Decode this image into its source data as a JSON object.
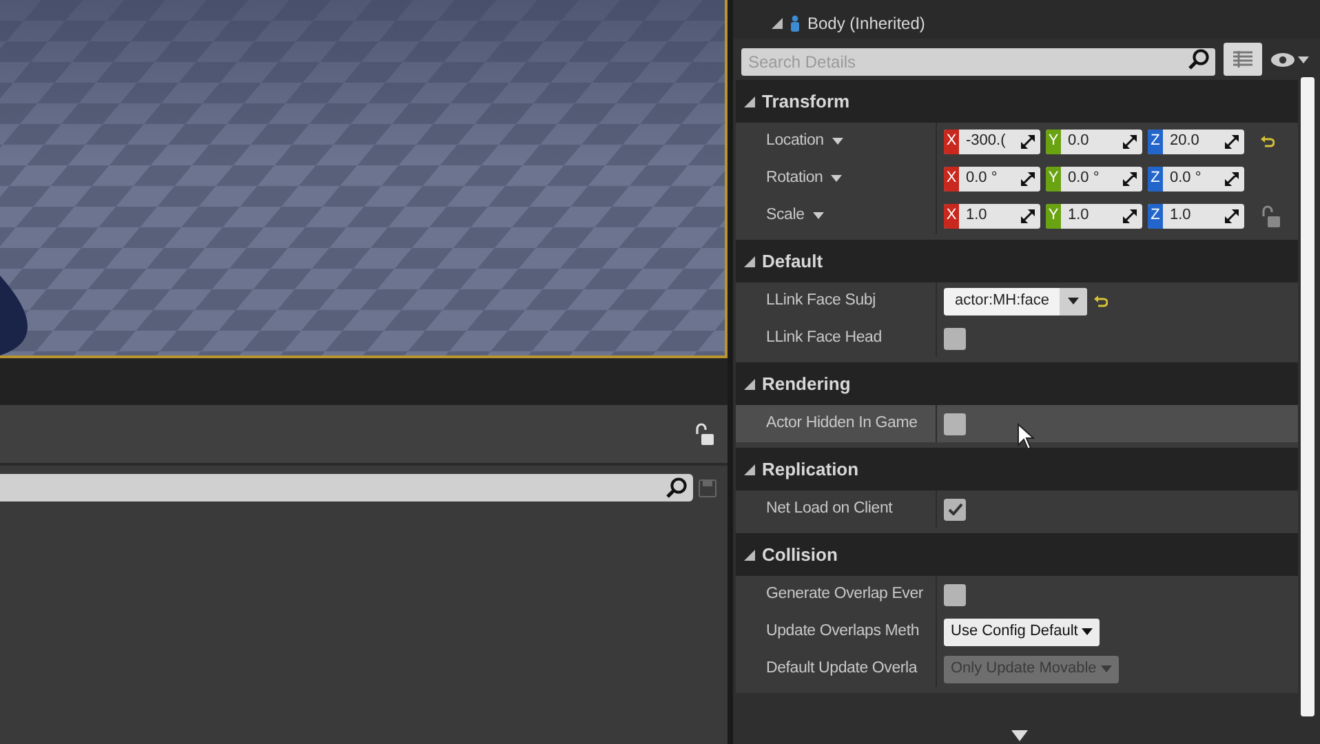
{
  "outliner": {
    "items": [
      {
        "label": "Body (Inherited)",
        "expanded": true
      }
    ]
  },
  "details": {
    "search": {
      "placeholder": "Search Details"
    },
    "sections": [
      {
        "title": "Transform",
        "expanded": true,
        "rows": [
          {
            "kind": "vector",
            "label": "Location",
            "modified": true,
            "hovered": false,
            "fields": [
              {
                "axis": "X",
                "value": "-300.("
              },
              {
                "axis": "Y",
                "value": "0.0"
              },
              {
                "axis": "Z",
                "value": "20.0"
              }
            ]
          },
          {
            "kind": "vector",
            "label": "Rotation",
            "modified": false,
            "hovered": false,
            "fields": [
              {
                "axis": "X",
                "value": "0.0 °"
              },
              {
                "axis": "Y",
                "value": "0.0 °"
              },
              {
                "axis": "Z",
                "value": "0.0 °"
              }
            ]
          },
          {
            "kind": "vector",
            "label": "Scale",
            "modified": false,
            "locked": false,
            "hovered": false,
            "fields": [
              {
                "axis": "X",
                "value": "1.0"
              },
              {
                "axis": "Y",
                "value": "1.0"
              },
              {
                "axis": "Z",
                "value": "1.0"
              }
            ]
          }
        ]
      },
      {
        "title": "Default",
        "expanded": true,
        "rows": [
          {
            "kind": "combo",
            "label": "LLink Face Subj",
            "value": "actor:MH:face",
            "modified": true,
            "hovered": false
          },
          {
            "kind": "checkbox",
            "label": "LLink Face Head",
            "checked": false,
            "hovered": false
          }
        ]
      },
      {
        "title": "Rendering",
        "expanded": true,
        "rows": [
          {
            "kind": "checkbox",
            "label": "Actor Hidden In Game",
            "checked": false,
            "hovered": true
          }
        ]
      },
      {
        "title": "Replication",
        "expanded": true,
        "rows": [
          {
            "kind": "checkbox",
            "label": "Net Load on Client",
            "checked": true,
            "hovered": false
          }
        ]
      },
      {
        "title": "Collision",
        "expanded": true,
        "rows": [
          {
            "kind": "checkbox",
            "label": "Generate Overlap Ever",
            "checked": false,
            "hovered": false
          },
          {
            "kind": "dropdown",
            "label": "Update Overlaps Meth",
            "value": "Use Config Default",
            "disabled": false,
            "hovered": false
          },
          {
            "kind": "dropdown",
            "label": "Default Update Overla",
            "value": "Only Update Movable",
            "disabled": true,
            "hovered": false
          }
        ]
      }
    ]
  }
}
